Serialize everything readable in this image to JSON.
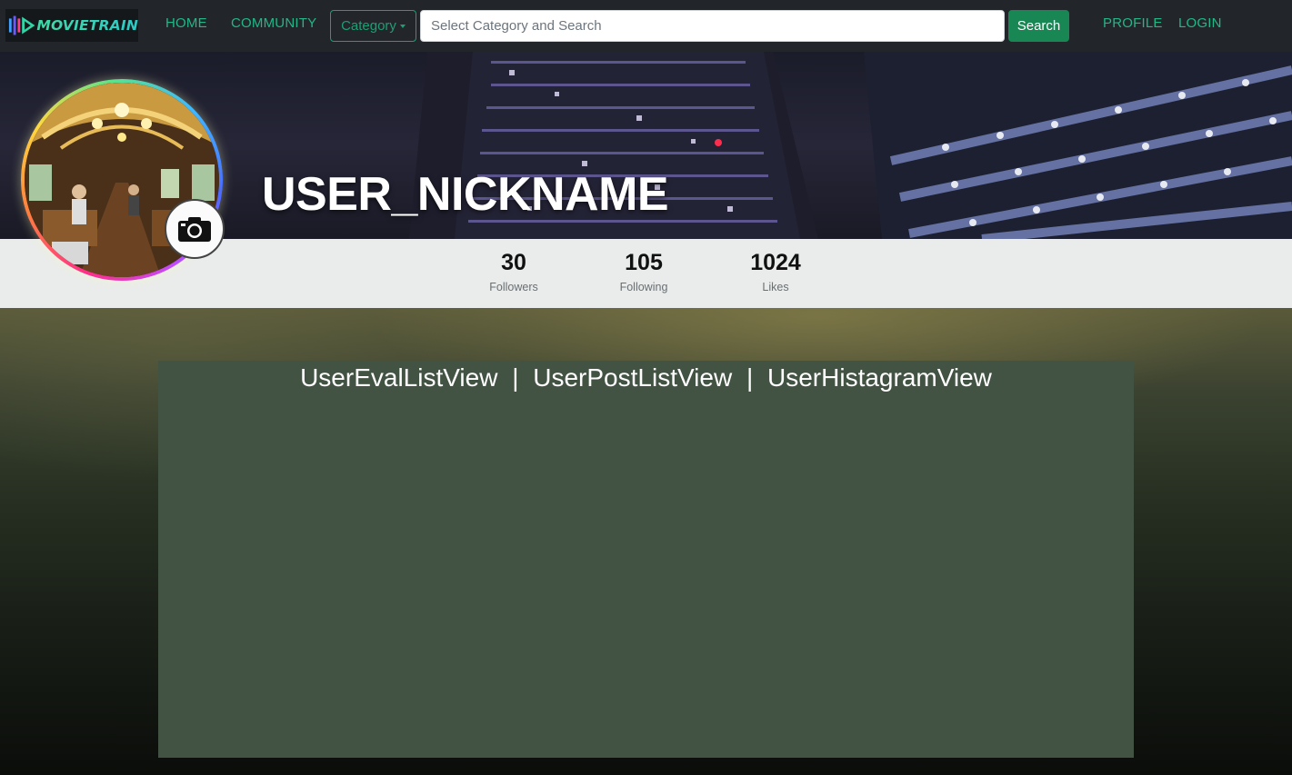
{
  "nav": {
    "logo_text": "MOVIETRAIN",
    "home": "HOME",
    "community": "COMMUNITY",
    "category": "Category",
    "search_placeholder": "Select Category and Search",
    "search_button": "Search",
    "profile": "PROFILE",
    "login": "LOGIN"
  },
  "profile": {
    "nickname": "USER_NICKNAME",
    "avatar_icon": "train-interior-photo",
    "camera_icon": "camera-icon"
  },
  "stats": [
    {
      "value": "30",
      "label": "Followers"
    },
    {
      "value": "105",
      "label": "Following"
    },
    {
      "value": "1024",
      "label": "Likes"
    }
  ],
  "views": {
    "eval": "UserEvalListView",
    "separator": "|",
    "post": "UserPostListView",
    "histagram": "UserHistagramView"
  },
  "colors": {
    "navbar_bg": "#22262a",
    "accent_green": "#198754",
    "link_green": "#23b686",
    "panel_bg": "#435343",
    "stats_bg": "#e9eceb"
  }
}
